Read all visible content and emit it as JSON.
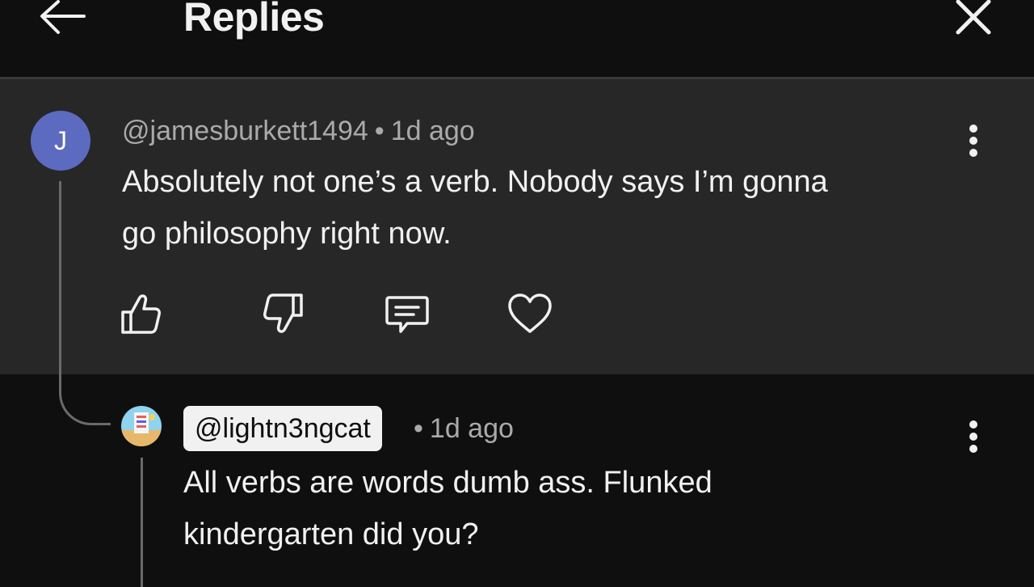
{
  "header": {
    "title": "Replies",
    "back_icon": "back-arrow-icon",
    "close_icon": "close-icon"
  },
  "parent_comment": {
    "avatar_letter": "J",
    "avatar_color": "#5c6bc0",
    "author": "@jamesburkett1494",
    "separator": "•",
    "time": "1d ago",
    "text_line1": "Absolutely not one’s a verb. Nobody says I’m gonna",
    "text_line2": "go philosophy right now.",
    "actions": [
      "thumbs-up-icon",
      "thumbs-down-icon",
      "reply-icon",
      "heart-icon"
    ]
  },
  "reply_comment": {
    "author": "@lightn3ngcat",
    "separator": "•",
    "time": "1d ago",
    "text_line1": "All verbs are words dumb ass. Flunked",
    "text_line2": "kindergarten did you?"
  },
  "colors": {
    "background": "#0f0f0f",
    "parent_background": "#272727",
    "secondary_text": "#aaaaaa"
  }
}
